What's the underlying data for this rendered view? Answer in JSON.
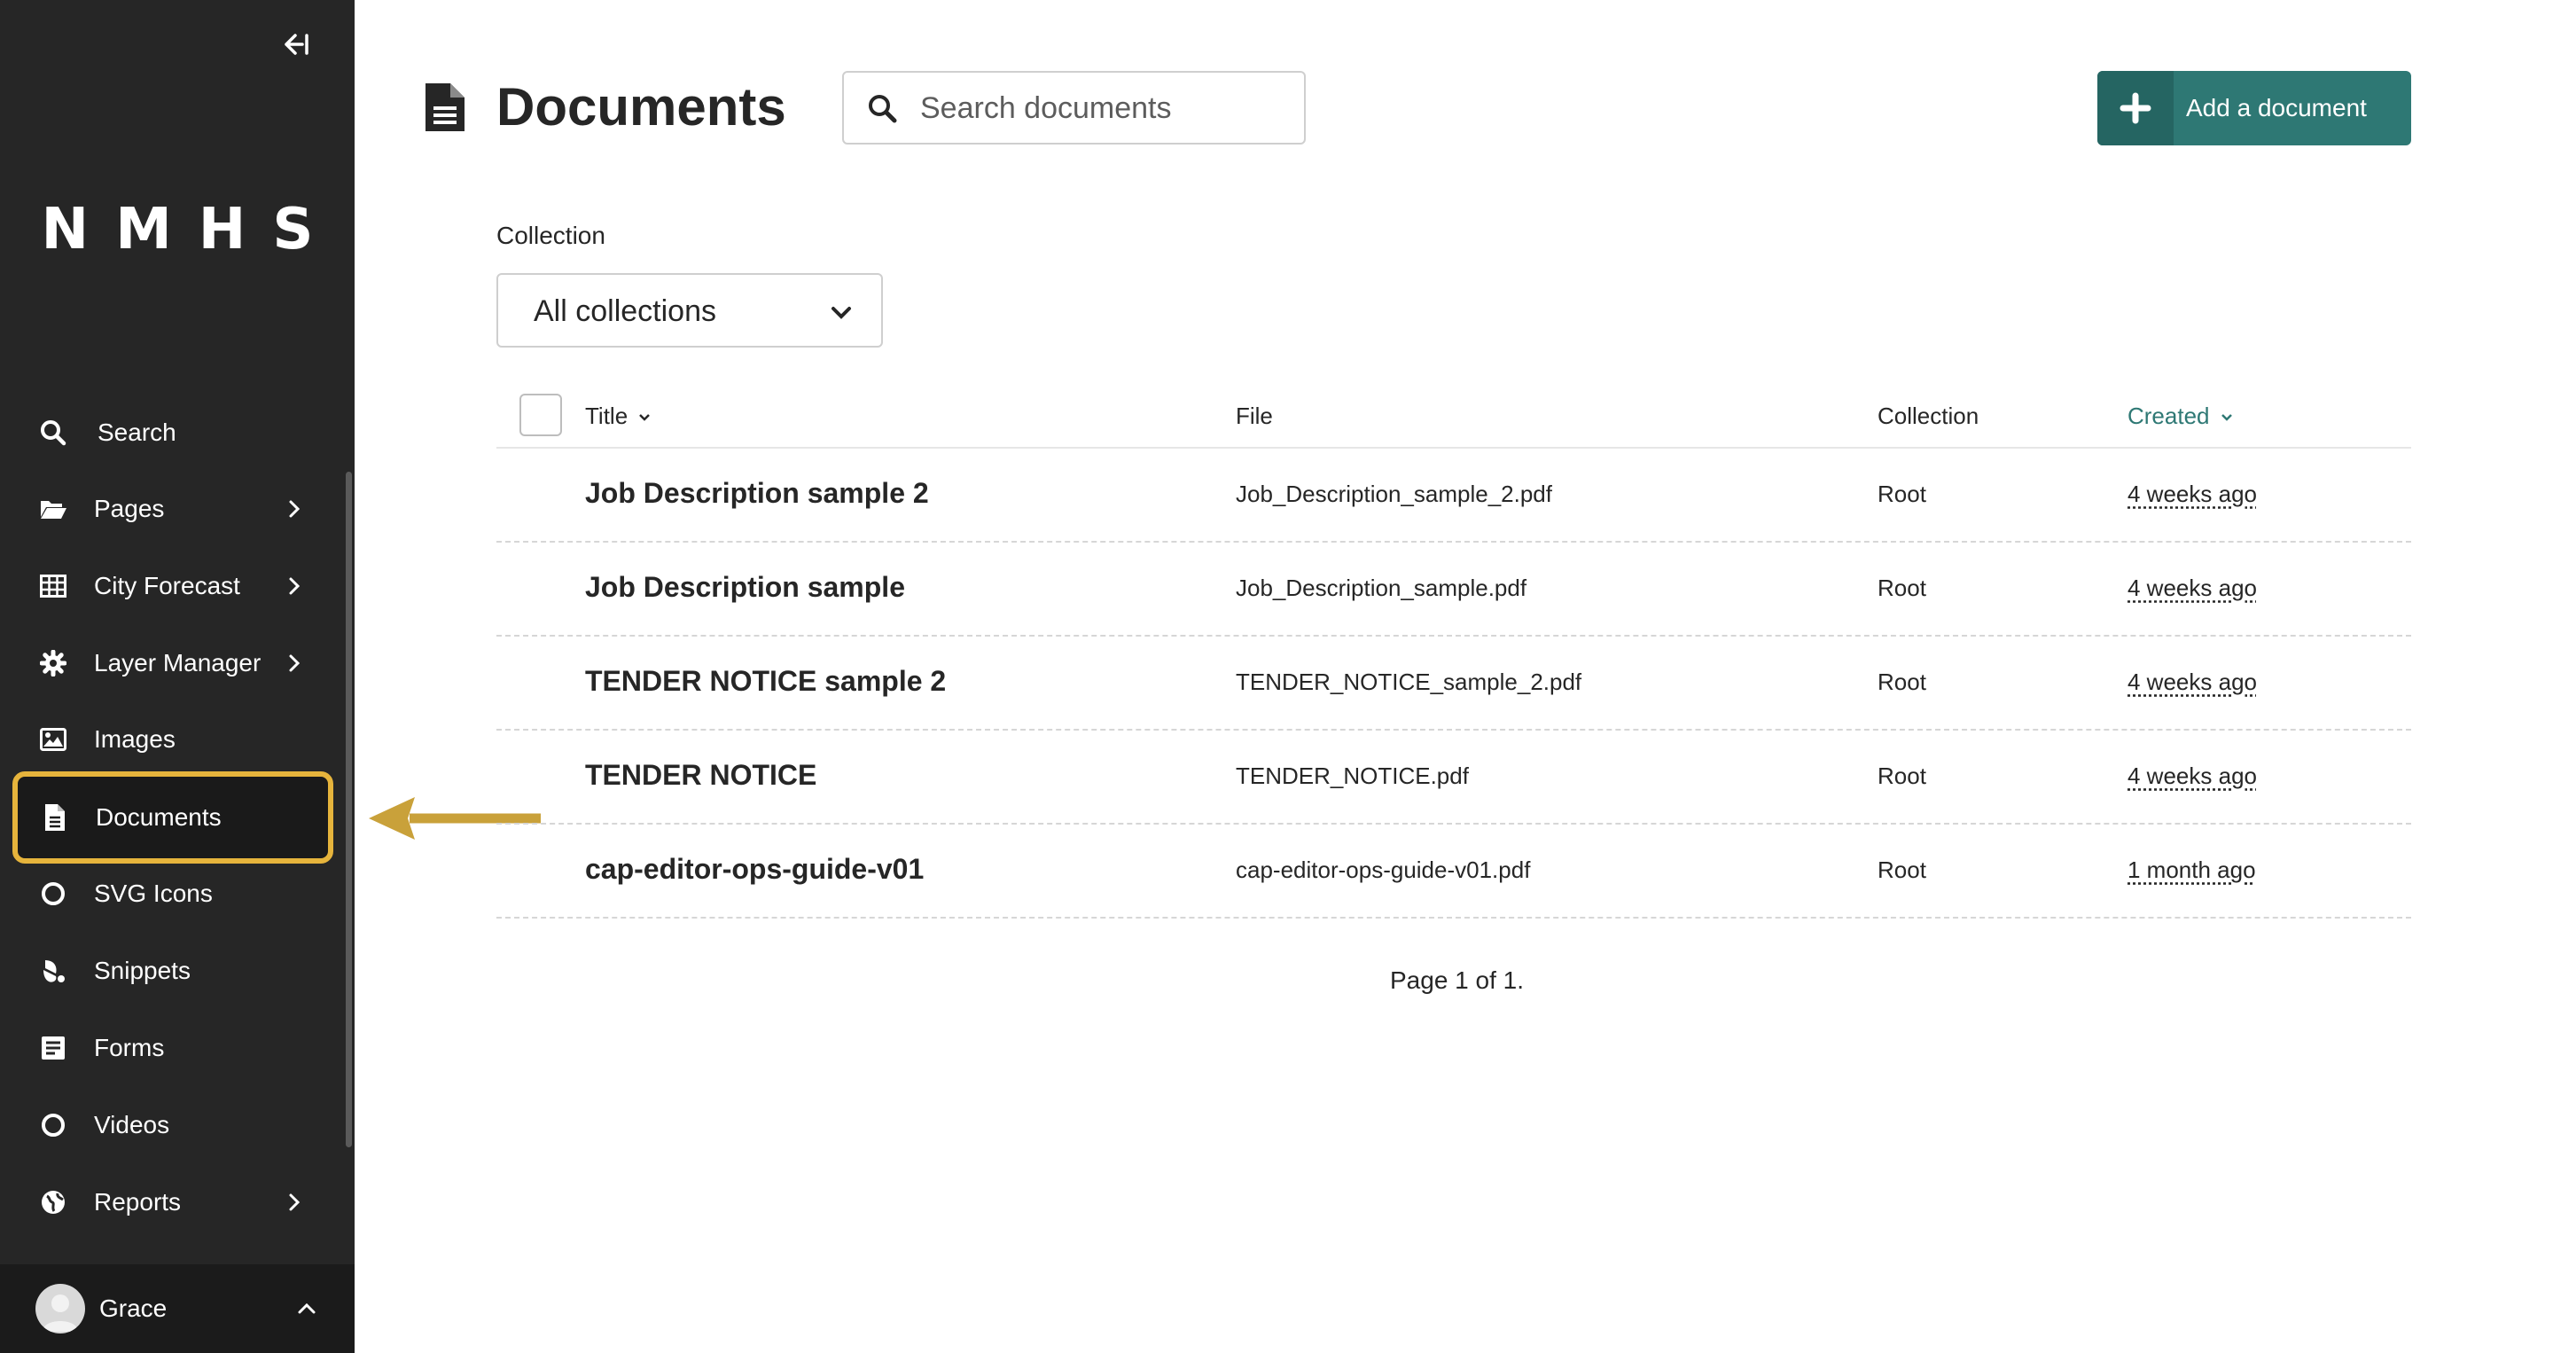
{
  "sidebar": {
    "logo": "NMHS",
    "items": [
      {
        "label": "Search",
        "icon": "search-icon",
        "has_submenu": false
      },
      {
        "label": "Pages",
        "icon": "folder-open-icon",
        "has_submenu": true
      },
      {
        "label": "City Forecast",
        "icon": "table-icon",
        "has_submenu": true
      },
      {
        "label": "Layer Manager",
        "icon": "gear-icon",
        "has_submenu": true
      },
      {
        "label": "Images",
        "icon": "image-icon",
        "has_submenu": false
      },
      {
        "label": "Documents",
        "icon": "document-icon",
        "has_submenu": false,
        "active": true
      },
      {
        "label": "SVG Icons",
        "icon": "circle-icon",
        "has_submenu": false
      },
      {
        "label": "Snippets",
        "icon": "snippet-icon",
        "has_submenu": false
      },
      {
        "label": "Forms",
        "icon": "form-icon",
        "has_submenu": false
      },
      {
        "label": "Videos",
        "icon": "circle-icon",
        "has_submenu": false
      },
      {
        "label": "Reports",
        "icon": "globe-icon",
        "has_submenu": true
      }
    ],
    "user": {
      "name": "Grace"
    }
  },
  "header": {
    "title": "Documents",
    "search_placeholder": "Search documents",
    "add_button_label": "Add a document"
  },
  "filters": {
    "collection_label": "Collection",
    "collection_value": "All collections"
  },
  "table": {
    "columns": {
      "title": "Title",
      "file": "File",
      "collection": "Collection",
      "created": "Created"
    },
    "rows": [
      {
        "title": "Job Description sample 2",
        "file": "Job_Description_sample_2.pdf",
        "collection": "Root",
        "created": "4 weeks ago"
      },
      {
        "title": "Job Description sample",
        "file": "Job_Description_sample.pdf",
        "collection": "Root",
        "created": "4 weeks ago"
      },
      {
        "title": "TENDER NOTICE sample 2",
        "file": "TENDER_NOTICE_sample_2.pdf",
        "collection": "Root",
        "created": "4 weeks ago"
      },
      {
        "title": "TENDER NOTICE",
        "file": "TENDER_NOTICE.pdf",
        "collection": "Root",
        "created": "4 weeks ago"
      },
      {
        "title": "cap-editor-ops-guide-v01",
        "file": "cap-editor-ops-guide-v01.pdf",
        "collection": "Root",
        "created": "1 month ago"
      }
    ]
  },
  "pagination": "Page 1 of 1.",
  "colors": {
    "sidebar_bg": "#262626",
    "accent": "#2e7874",
    "highlight": "#e6b43c"
  }
}
